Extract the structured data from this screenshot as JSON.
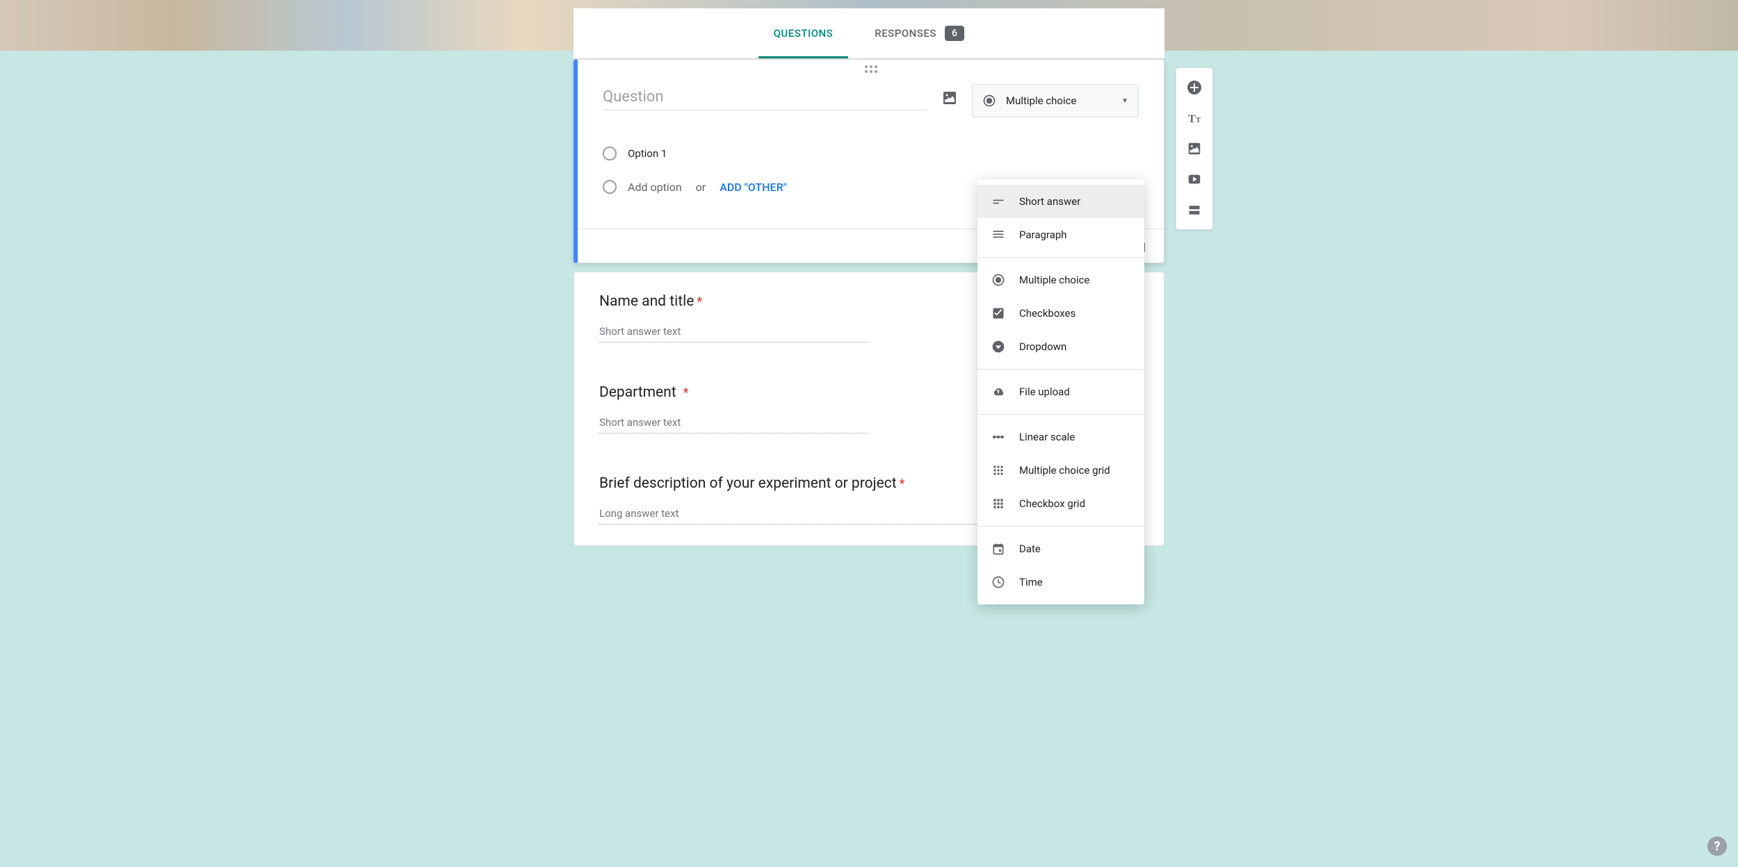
{
  "tabs": {
    "questions": "QUESTIONS",
    "responses": "RESPONSES",
    "response_count": "6"
  },
  "editor": {
    "question_placeholder": "Question",
    "selected_type": "Multiple choice",
    "option1": "Option 1",
    "add_option": "Add option",
    "or": "or",
    "add_other": "ADD \"OTHER\""
  },
  "type_menu": {
    "short_answer": "Short answer",
    "paragraph": "Paragraph",
    "multiple_choice": "Multiple choice",
    "checkboxes": "Checkboxes",
    "dropdown": "Dropdown",
    "file_upload": "File upload",
    "linear_scale": "Linear scale",
    "mc_grid": "Multiple choice grid",
    "checkbox_grid": "Checkbox grid",
    "date": "Date",
    "time": "Time"
  },
  "questions": {
    "q1": {
      "title": "Name and title",
      "placeholder": "Short answer text"
    },
    "q2": {
      "title": "Department",
      "placeholder": "Short answer text"
    },
    "q3": {
      "title": "Brief description of your experiment or project",
      "placeholder": "Long answer text"
    }
  },
  "help": "?"
}
